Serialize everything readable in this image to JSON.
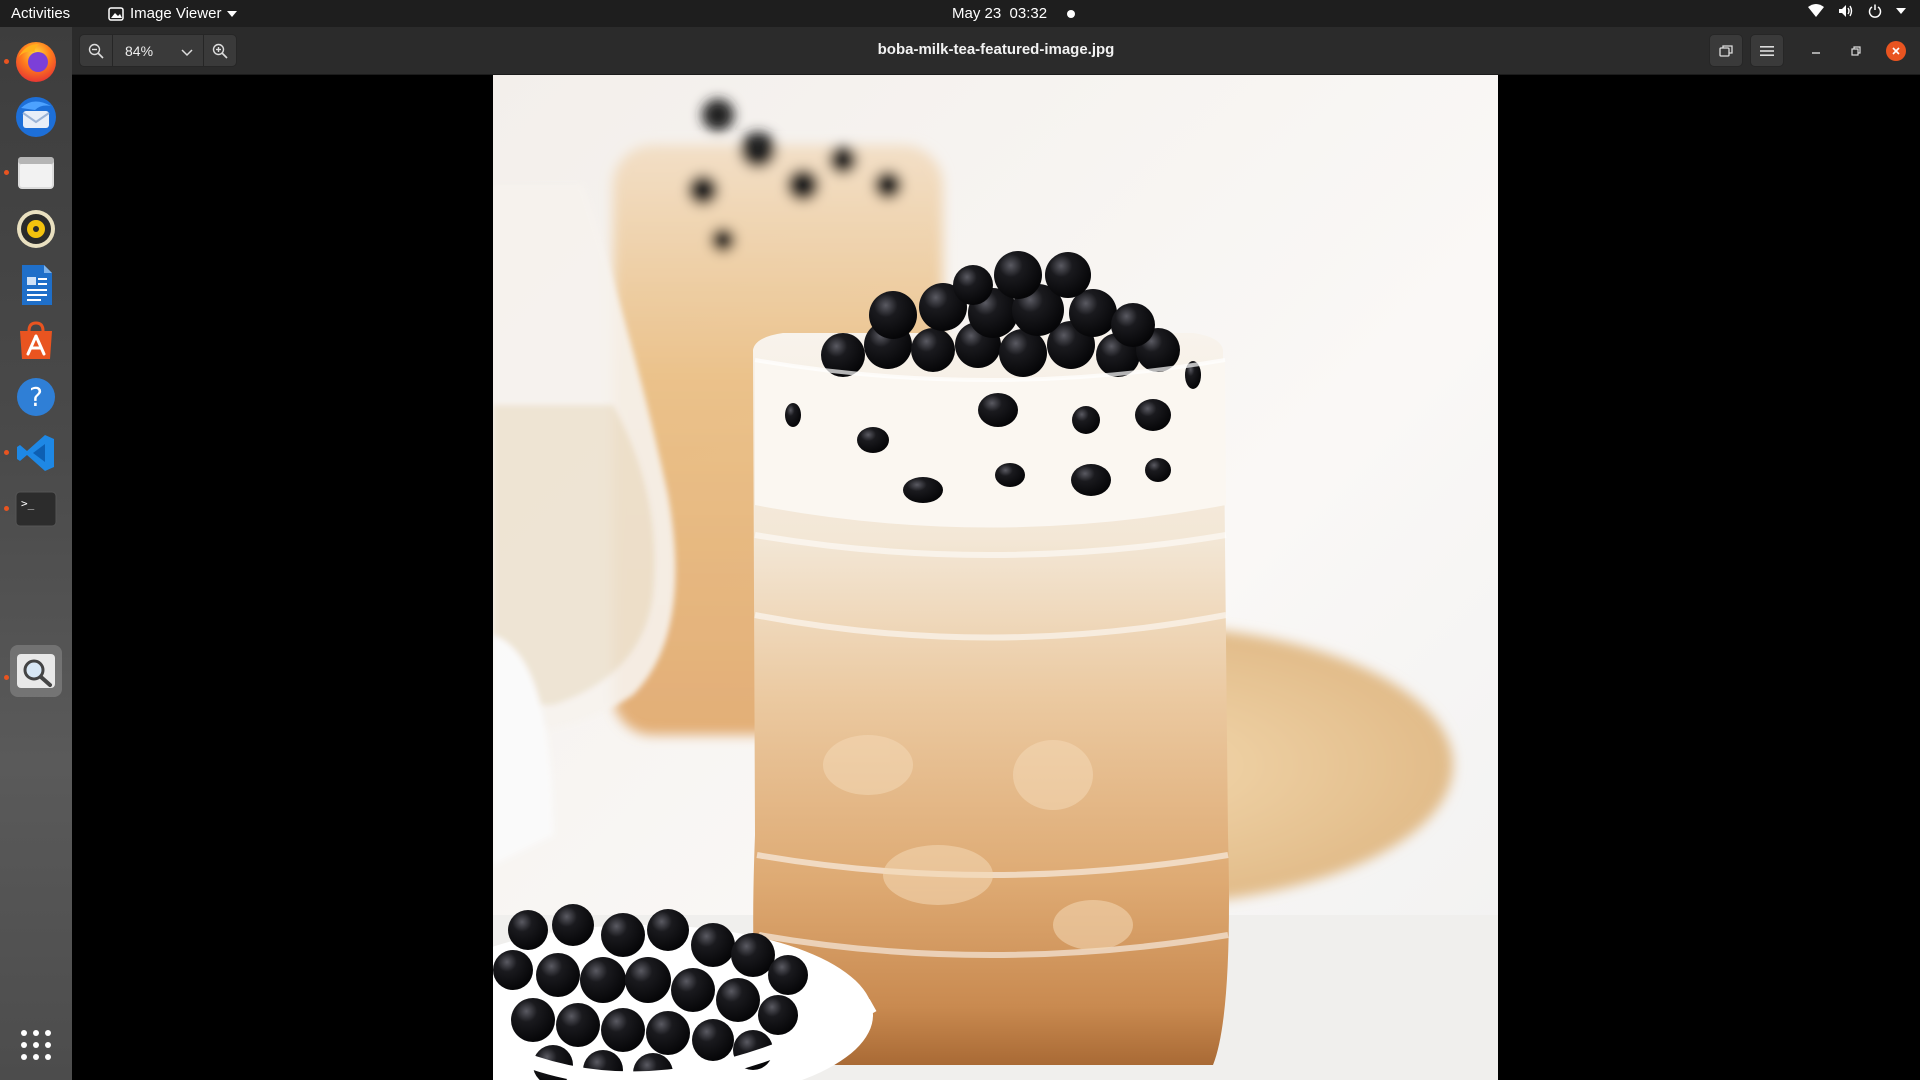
{
  "topbar": {
    "activities": "Activities",
    "app_menu": "Image Viewer",
    "date": "May 23",
    "time": "03:32"
  },
  "dock": {
    "items": [
      {
        "name": "firefox-icon"
      },
      {
        "name": "thunderbird-icon"
      },
      {
        "name": "files-icon"
      },
      {
        "name": "rhythmbox-icon"
      },
      {
        "name": "writer-icon"
      },
      {
        "name": "software-icon"
      },
      {
        "name": "help-icon"
      },
      {
        "name": "vscode-icon"
      },
      {
        "name": "terminal-icon"
      },
      {
        "name": "image-viewer-icon"
      }
    ]
  },
  "viewer": {
    "zoom": "84%",
    "filename": "boba-milk-tea-featured-image.jpg"
  },
  "colors": {
    "accent": "#e95420",
    "header_bg": "#2b2b2b",
    "topbar_bg": "#1e1e1e"
  }
}
